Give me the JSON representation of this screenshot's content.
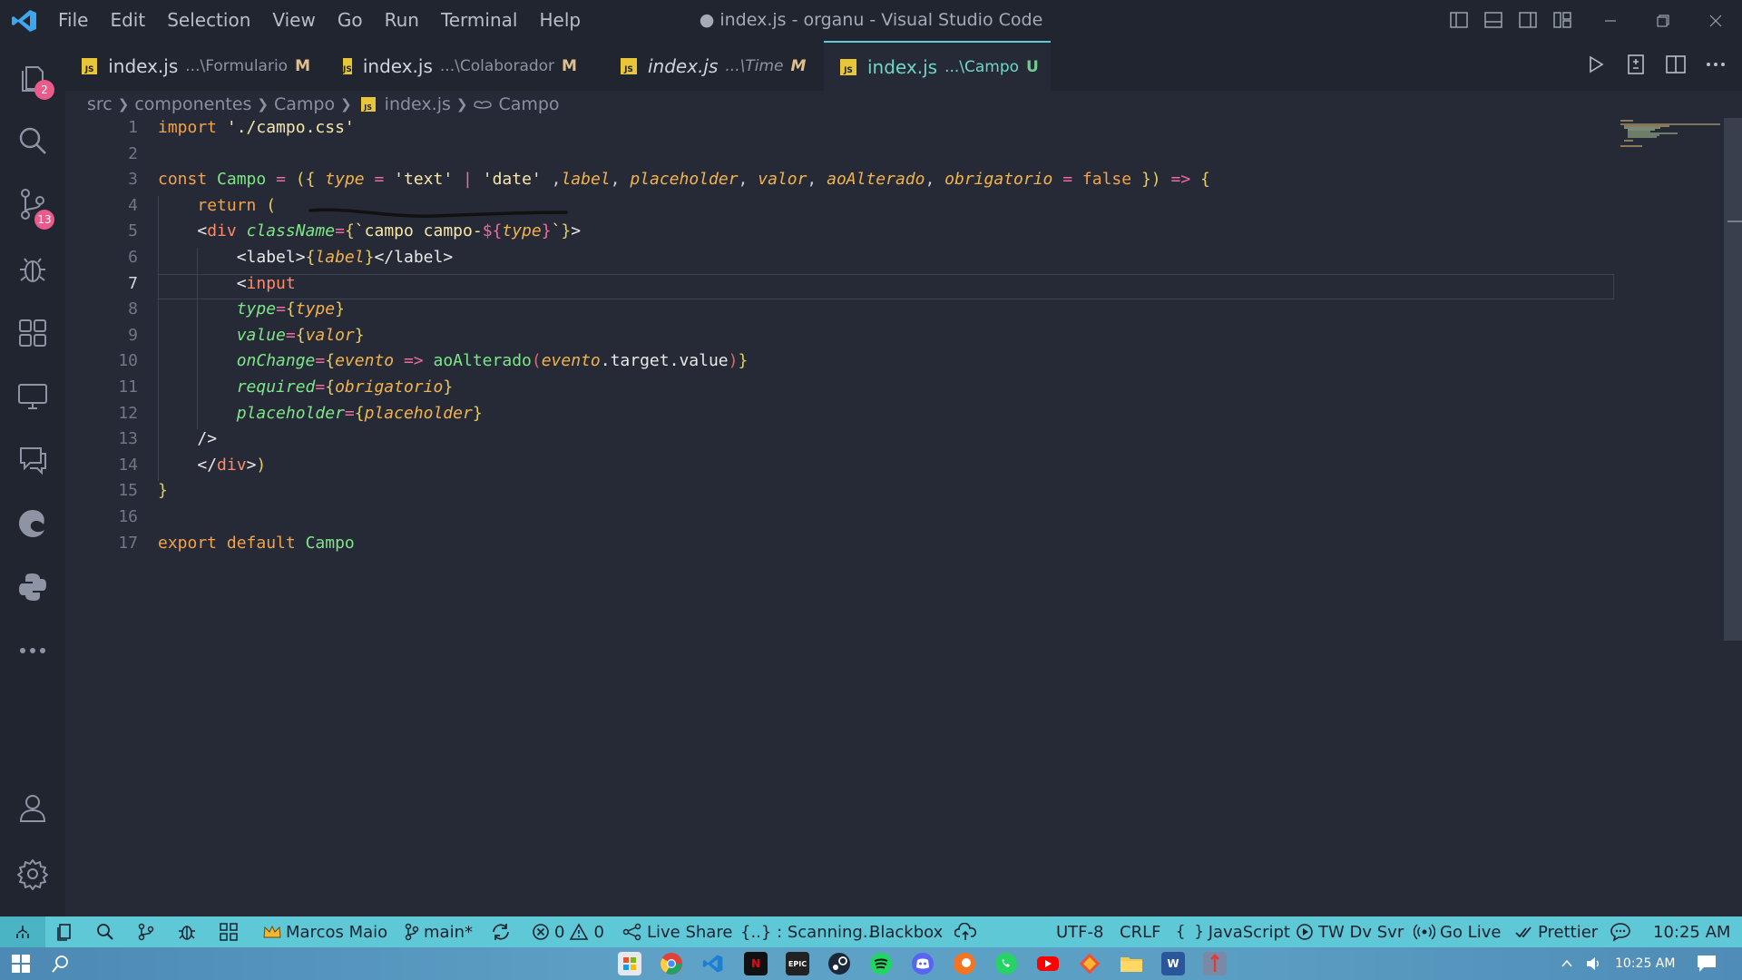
{
  "titlebar": {
    "menu": [
      "File",
      "Edit",
      "Selection",
      "View",
      "Go",
      "Run",
      "Terminal",
      "Help"
    ],
    "window_title": "● index.js - organu - Visual Studio Code"
  },
  "activity_bar": {
    "explorer_badge": "2",
    "source_control_badge": "13"
  },
  "tabs": [
    {
      "file": "index.js",
      "path": "...\\Formulario",
      "mark": "M",
      "color": "#e2c08d"
    },
    {
      "file": "index.js",
      "path": "...\\Colaborador",
      "mark": "M",
      "color": "#e2c08d"
    },
    {
      "file": "index.js",
      "path": "...\\Time",
      "mark": "M",
      "color": "#e2c08d"
    },
    {
      "file": "index.js",
      "path": "...\\Campo",
      "mark": "U",
      "color": "#73c991"
    }
  ],
  "breadcrumb": [
    "src",
    "componentes",
    "Campo",
    "index.js",
    "Campo"
  ],
  "editor": {
    "line_numbers": [
      "1",
      "2",
      "3",
      "4",
      "5",
      "6",
      "7",
      "8",
      "9",
      "10",
      "11",
      "12",
      "13",
      "14",
      "15",
      "16",
      "17"
    ],
    "current_line": 7,
    "code": {
      "l1_import": "import",
      "l1_path": "'./campo.css'",
      "l3_const": "const",
      "l3_name": "Campo",
      "l3_type": "type",
      "l3_text": "'text'",
      "l3_date": "'date'",
      "l3_label": "label",
      "l3_placeholder": "placeholder",
      "l3_valor": "valor",
      "l3_aoAlterado": "aoAlterado",
      "l3_obrigatorio": "obrigatorio",
      "l3_false": "false",
      "l4_return": "return",
      "l5_div": "div",
      "l5_attr": "className",
      "l5_tpl": "campo campo-",
      "l5_type": "type",
      "l6_label_open": "label",
      "l6_label_var": "label",
      "l6_label_close": "label",
      "l7_input": "input",
      "l8_attr": "type",
      "l8_val": "type",
      "l9_attr": "value",
      "l9_val": "valor",
      "l10_attr": "onChange",
      "l10_evento": "evento",
      "l10_fn": "aoAlterado",
      "l10_evento2": "evento",
      "l10_prop": ".target.value",
      "l11_attr": "required",
      "l11_val": "obrigatorio",
      "l12_attr": "placeholder",
      "l12_val": "placeholder",
      "l14_div": "div",
      "l17_export": "export default",
      "l17_name": "Campo"
    }
  },
  "statusbar": {
    "user": "Marcos Maio",
    "branch": "main*",
    "errors": "0",
    "warnings": "0",
    "live_share": "Live Share",
    "scanning": "{..} : Scanning..",
    "blackbox": "Blackbox",
    "encoding": "UTF-8",
    "eol": "CRLF",
    "language": "JavaScript",
    "tw_dv_svr": "TW Dv Svr",
    "go_live": "Go Live",
    "prettier": "Prettier",
    "time": "10:25 AM"
  },
  "taskbar": {
    "time": "10:25 AM"
  },
  "colors": {
    "accent": "#5ec8d6",
    "badge": "#e85b8a",
    "editor_bg": "#262a37",
    "chrome_bg": "#21252f"
  }
}
